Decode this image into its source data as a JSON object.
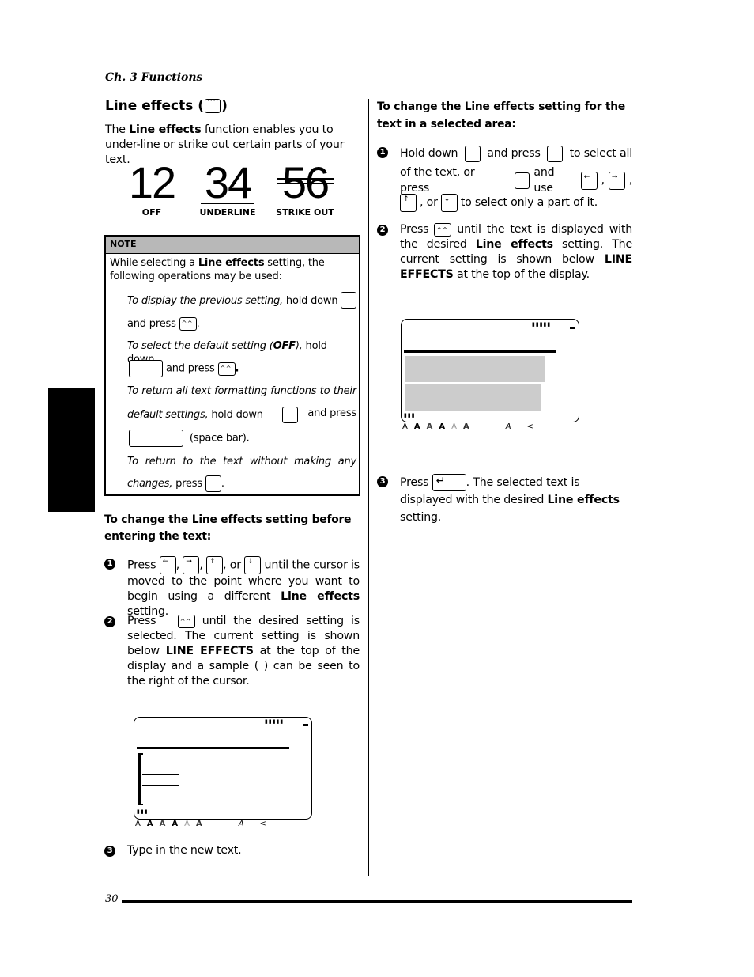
{
  "header": {
    "chapter": "Ch. 3 Functions"
  },
  "side_tab": {
    "color": "#000000"
  },
  "left": {
    "title": "Line effects (",
    "title_close": ")",
    "intro": [
      "The ",
      "Line effects",
      " function enables you to under-line or strike out certain parts of your text."
    ],
    "samples": [
      {
        "digits": "12",
        "label": "OFF",
        "effect": "none"
      },
      {
        "digits": "34",
        "label": "UNDERLINE",
        "effect": "underline"
      },
      {
        "digits": "56",
        "label": "STRIKE OUT",
        "effect": "strike"
      }
    ],
    "note": {
      "header": "NOTE",
      "header_bg": "#b8b8b8",
      "intro_a": "While selecting a ",
      "intro_b": "Line effects",
      "intro_c": " setting, the following operations may be used:",
      "items": [
        {
          "italic": "To display the previous setting,",
          "a": " hold down",
          "b": "and press",
          "c": "."
        },
        {
          "italic_a": "To select the default setting (",
          "bold": "OFF",
          "italic_b": "),",
          "a": " hold down",
          "b": "and press",
          "c": "."
        },
        {
          "italic_a": "To return all text formatting functions to their",
          "italic_b": "default settings,",
          "a": " hold down",
          "b": "and press",
          "c": "(space bar)."
        },
        {
          "italic_a": "To return to the text without making any",
          "italic_b": "changes,",
          "a": " press",
          "c": "."
        }
      ]
    },
    "section_heading": "To change the Line effects setting before entering the text:",
    "steps": [
      {
        "num": "1",
        "a": "Press",
        "sep1": ",",
        "sep2": ",",
        "sep3": ", or",
        "b": "until the cursor is moved to the point where you want to begin using a different ",
        "bold": "Line effects",
        "c": " setting."
      },
      {
        "num": "2",
        "a": "Press",
        "b": " until the desired setting is selected. The current setting is shown below ",
        "bold": "LINE EFFECTS",
        "c": " at the top of the display and a sample (  ) can be seen to the right of the cursor."
      },
      {
        "num": "3",
        "a": "Type in the new text."
      }
    ],
    "lcd_icons": [
      "A",
      "A",
      "A",
      "A",
      "A",
      "A",
      "A",
      "<"
    ]
  },
  "right": {
    "section_heading": "To change the Line effects setting for the text in a selected area:",
    "steps": [
      {
        "num": "1",
        "a": "Hold down",
        "b": "and press",
        "c": "to select all",
        "d": "of the text, or press",
        "e": "and use",
        "f": ",",
        "g": ",",
        "h": ", or",
        "i": "to select only a part of it."
      },
      {
        "num": "2",
        "a": "Press",
        "b": " until the text is displayed with the desired ",
        "bold": "Line effects",
        "c": " setting. The current setting is shown below ",
        "bold2": "LINE EFFECTS",
        "d": " at the top of the display."
      },
      {
        "num": "3",
        "a": "Press",
        "b": ". The selected text is displayed with the desired ",
        "bold": "Line effects",
        "c": " setting."
      }
    ],
    "lcd_icons": [
      "A",
      "A",
      "A",
      "A",
      "A",
      "A",
      "A",
      "<"
    ],
    "selection_color": "#cccccc"
  },
  "keys": {
    "left_arrow": "←",
    "right_arrow": "→",
    "up_arrow": "↑",
    "down_arrow": "↓",
    "left_sub": "|◂",
    "right_sub": "▸|",
    "up_sub": "⊤",
    "down_sub": "⊥",
    "enter": "↵"
  },
  "footer": {
    "page_number": "30"
  }
}
